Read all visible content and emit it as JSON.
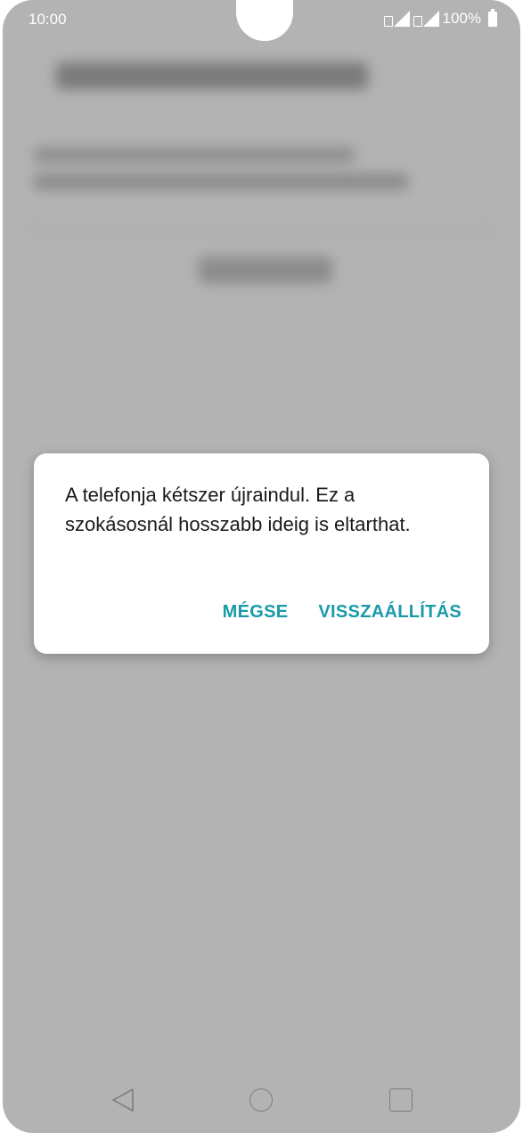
{
  "status_bar": {
    "time": "10:00",
    "battery": "100%"
  },
  "dialog": {
    "message": "A telefonja kétszer újraindul. Ez a szokásosnál hosszabb ideig is eltarthat.",
    "cancel_label": "MÉGSE",
    "confirm_label": "VISSZAÁLLÍTÁS"
  },
  "nav_bar": {
    "back_icon": "back-triangle-icon",
    "home_icon": "home-circle-icon",
    "recent_icon": "recent-apps-square-icon"
  },
  "colors": {
    "accent": "#1b9aaa",
    "scrim": "#b3b3b3"
  }
}
